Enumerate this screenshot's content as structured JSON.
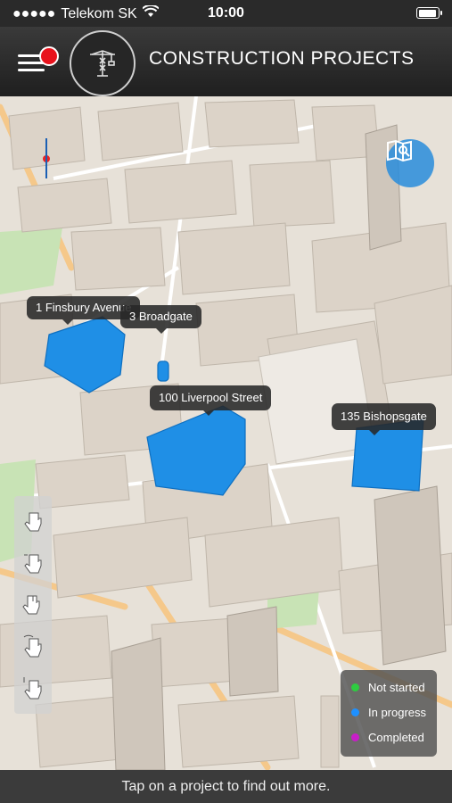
{
  "status_bar": {
    "carrier": "Telekom SK",
    "time": "10:00",
    "battery_level": 0.95
  },
  "header": {
    "title": "CONSTRUCTION PROJECTS"
  },
  "projects": [
    {
      "label": "1 Finsbury Avenue",
      "status": "In progress"
    },
    {
      "label": "3 Broadgate",
      "status": "In progress"
    },
    {
      "label": "100 Liverpool Street",
      "status": "In progress"
    },
    {
      "label": "135 Bishopsgate",
      "status": "In progress"
    }
  ],
  "legend": {
    "items": [
      {
        "label": "Not started",
        "color": "#2ecc40"
      },
      {
        "label": "In progress",
        "color": "#1e90ff"
      },
      {
        "label": "Completed",
        "color": "#c81ec8"
      }
    ]
  },
  "footer": {
    "hint": "Tap on a project to find out more."
  },
  "icons": [
    "menu-icon",
    "crane-logo-icon",
    "map-search-icon",
    "hand-gesture-icon"
  ],
  "colors": {
    "accent_blue": "#1e90ff",
    "notification": "#e8121c",
    "header_bg": "#2a2a2a"
  }
}
